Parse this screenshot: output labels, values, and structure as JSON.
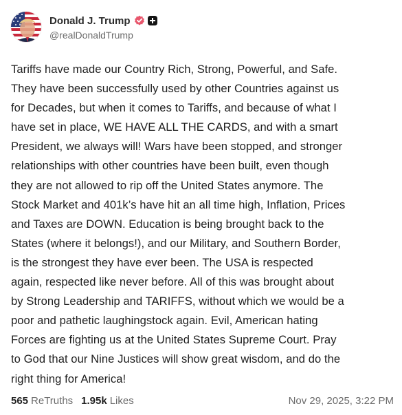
{
  "author": {
    "display_name": "Donald J. Trump",
    "handle": "@realDonaldTrump",
    "verified_icon": "verified-badge-icon",
    "plus_icon": "plus-badge-icon",
    "verified_color": "#e8566c"
  },
  "post": {
    "lines": [
      "Tariffs have made our Country Rich, Strong, Powerful, and Safe.",
      "They have been successfully used by other Countries against us",
      "for Decades, but when it comes to Tariffs, and because of what I",
      "have set in place, WE HAVE ALL THE CARDS, and with a smart",
      "President, we always will! Wars have been stopped, and stronger",
      "relationships with other countries have been built, even though",
      "they are not allowed to rip off the United States anymore. The",
      "Stock Market and 401k’s have hit an all time high, Inflation, Prices",
      "and Taxes are DOWN. Education is being brought back to the",
      "States (where it belongs!), and our Military, and Southern Border,",
      "is the strongest they have ever been. The USA is respected",
      "again, respected like never before. All of this was brought about",
      "by Strong Leadership and TARIFFS, without which we would be a",
      "poor and pathetic laughingstock again. Evil, American hating",
      "Forces are fighting us at the United States Supreme Court. Pray",
      "to God that our Nine Justices will show great wisdom, and do the",
      "right thing for America!"
    ]
  },
  "stats": {
    "retruths_count": "565",
    "retruths_label": "ReTruths",
    "likes_count": "1.95k",
    "likes_label": "Likes"
  },
  "timestamp": "Nov 29, 2025, 3:22 PM"
}
